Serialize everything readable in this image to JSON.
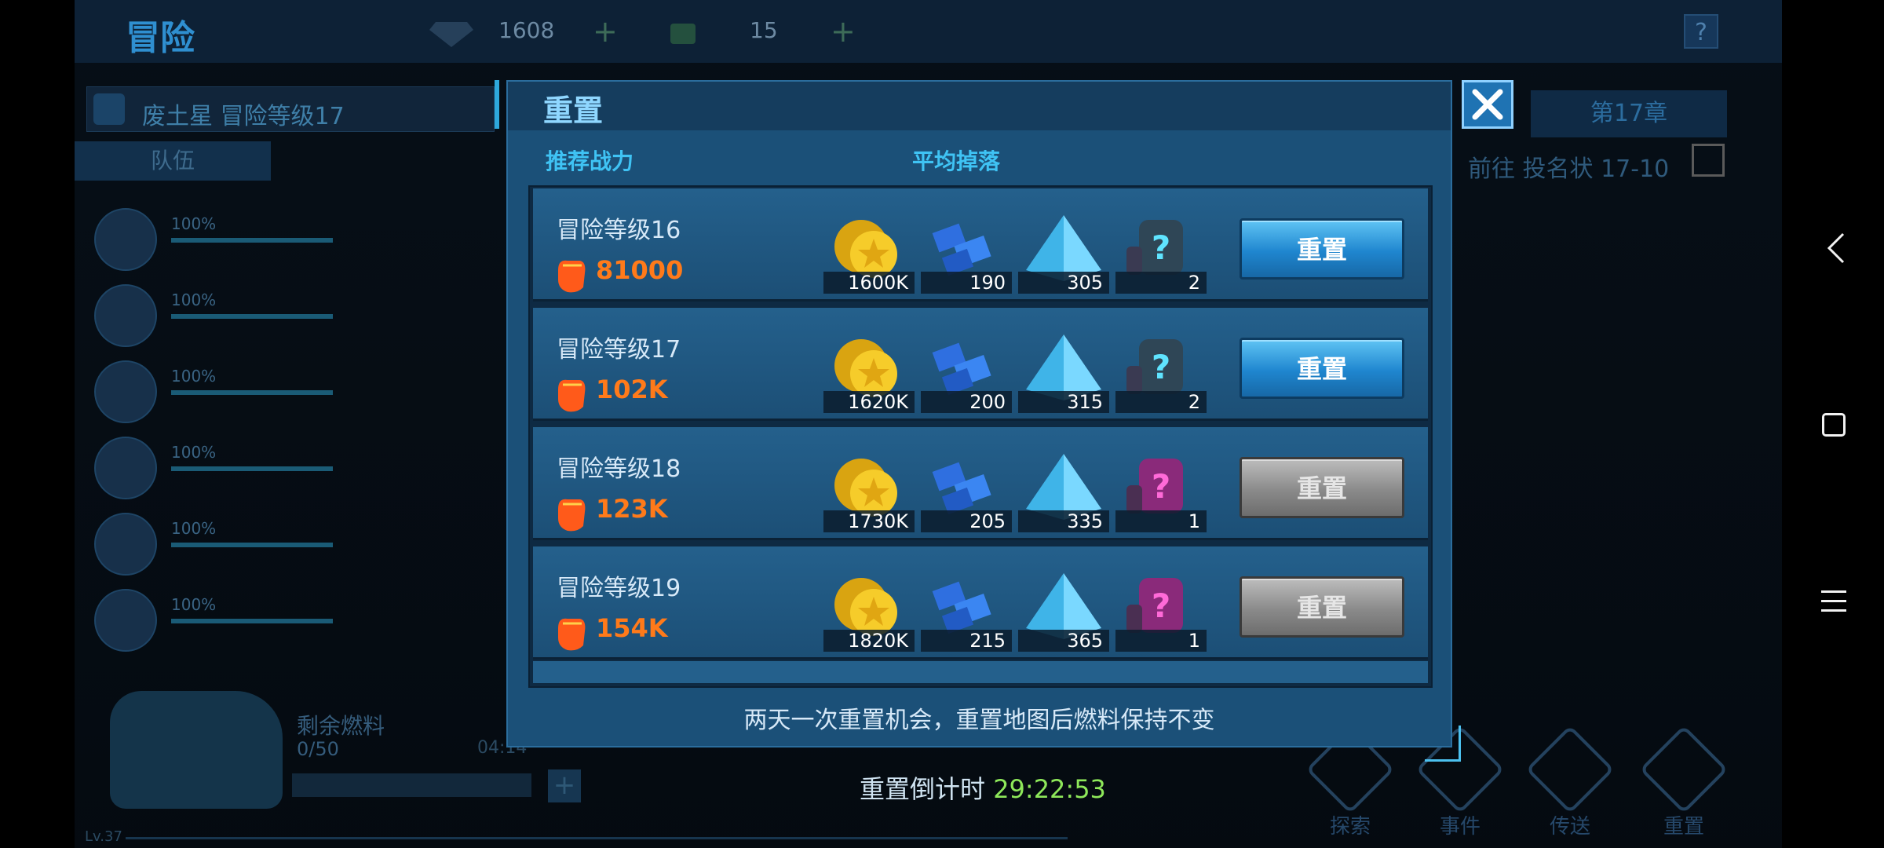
{
  "background": {
    "title": "冒险",
    "gems": "1608",
    "fuel": "15",
    "help": "?",
    "search_text": "废土星  冒险等级17",
    "team_tab": "队伍",
    "heroes": [
      {
        "pct": "100%"
      },
      {
        "pct": "100%"
      },
      {
        "pct": "100%"
      },
      {
        "pct": "100%"
      },
      {
        "pct": "100%"
      },
      {
        "pct": "100%"
      }
    ],
    "chapter": "第17章",
    "goto": "前往 投名状 17-10",
    "fuel_label": "剩余燃料",
    "fuel_value": "0/50",
    "fuel_timer": "04:14",
    "level": "Lv.37",
    "actions": [
      {
        "label": "探索"
      },
      {
        "label": "事件"
      },
      {
        "label": "传送"
      },
      {
        "label": "重置"
      }
    ]
  },
  "modal": {
    "title": "重置",
    "col_power": "推荐战力",
    "col_drop": "平均掉落",
    "rows": [
      {
        "name": "冒险等级16",
        "power": "81000",
        "coins": "1600K",
        "blocks": "190",
        "crystals": "305",
        "armor": "2",
        "armor_color": "cyan",
        "button": "重置",
        "enabled": true
      },
      {
        "name": "冒险等级17",
        "power": "102K",
        "coins": "1620K",
        "blocks": "200",
        "crystals": "315",
        "armor": "2",
        "armor_color": "cyan",
        "button": "重置",
        "enabled": true
      },
      {
        "name": "冒险等级18",
        "power": "123K",
        "coins": "1730K",
        "blocks": "205",
        "crystals": "335",
        "armor": "1",
        "armor_color": "magenta",
        "button": "重置",
        "enabled": false
      },
      {
        "name": "冒险等级19",
        "power": "154K",
        "coins": "1820K",
        "blocks": "215",
        "crystals": "365",
        "armor": "1",
        "armor_color": "magenta",
        "button": "重置",
        "enabled": false
      }
    ],
    "note": "两天一次重置机会，重置地图后燃料保持不变"
  },
  "countdown": {
    "label": "重置倒计时",
    "time": "29:22:53"
  },
  "colors": {
    "accent": "#3fc3f4",
    "power": "#ff7a1a",
    "timer": "#8ee85a"
  }
}
